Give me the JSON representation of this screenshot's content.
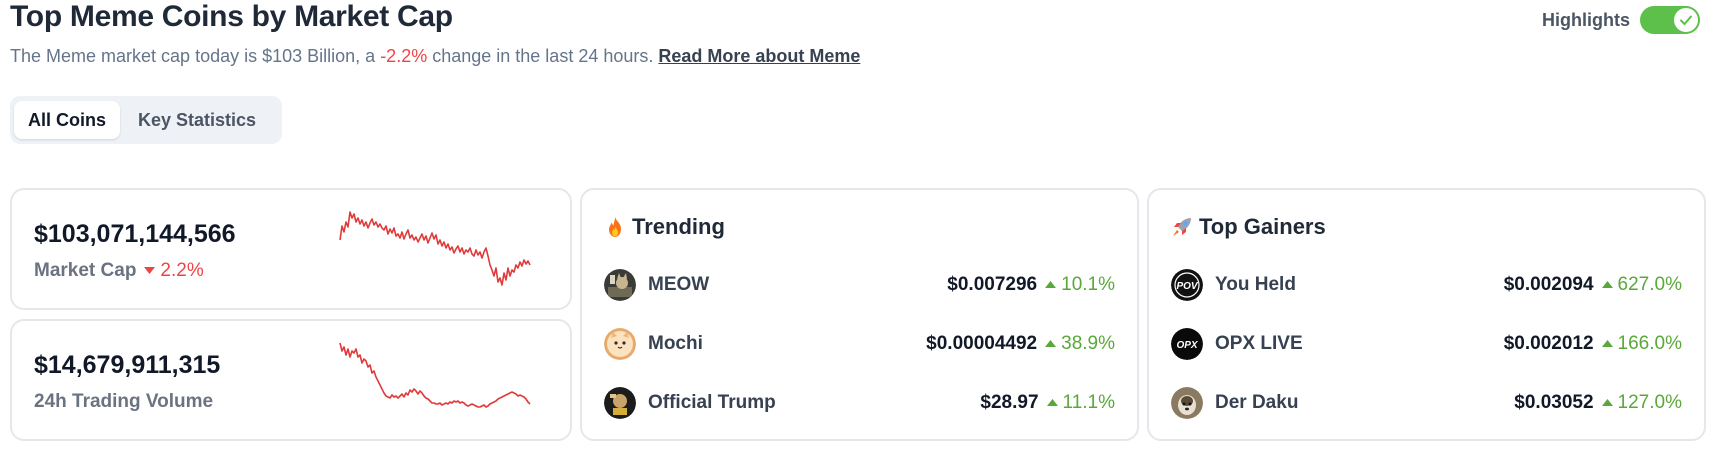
{
  "page": {
    "title": "Top Meme Coins by Market Cap",
    "subtitle_prefix": "The Meme market cap today is $103 Billion, a ",
    "subtitle_change": "-2.2%",
    "subtitle_suffix": " change in the last 24 hours. ",
    "read_more": "Read More about Meme"
  },
  "highlights": {
    "label": "Highlights",
    "enabled": true
  },
  "tabs": [
    {
      "label": "All Coins",
      "active": true
    },
    {
      "label": "Key Statistics",
      "active": false
    }
  ],
  "stats": [
    {
      "value": "$103,071,144,566",
      "label": "Market Cap",
      "change": "2.2%",
      "direction": "down",
      "icon": "triangle-down-icon"
    },
    {
      "value": "$14,679,911,315",
      "label": "24h Trading Volume"
    }
  ],
  "trending": {
    "title": "Trending",
    "icon": "fire-emoji",
    "items": [
      {
        "name": "MEOW",
        "price": "$0.007296",
        "change": "10.1%"
      },
      {
        "name": "Mochi",
        "price": "$0.00004492",
        "change": "38.9%"
      },
      {
        "name": "Official Trump",
        "price": "$28.97",
        "change": "11.1%"
      }
    ]
  },
  "gainers": {
    "title": "Top Gainers",
    "icon": "rocket-emoji",
    "items": [
      {
        "name": "You Held",
        "price": "$0.002094",
        "change": "627.0%",
        "logo_text": "POV"
      },
      {
        "name": "OPX LIVE",
        "price": "$0.002012",
        "change": "166.0%",
        "logo_text": "OPX"
      },
      {
        "name": "Der Daku",
        "price": "$0.03052",
        "change": "127.0%"
      }
    ]
  },
  "colors": {
    "positive": "#5aa83a",
    "negative": "#ef4444",
    "toggle": "#5dc04a",
    "sparkline": "#e03a3a"
  }
}
